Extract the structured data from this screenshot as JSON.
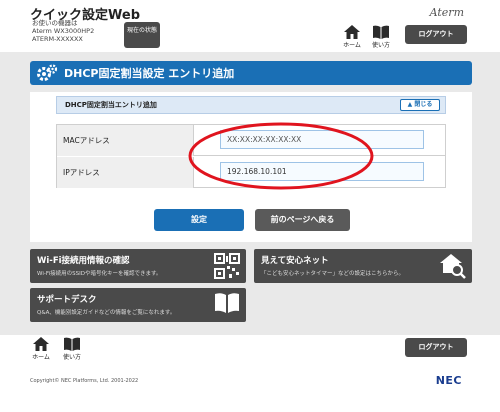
{
  "header": {
    "app_title": "クイック設定Web",
    "device_caption": "お使いの機器は",
    "device_model": "Aterm  WX3000HP2",
    "device_name": "ATERM-XXXXXX",
    "status_button": "現在の状態",
    "brand": "Aterm",
    "home_label": "ホーム",
    "howto_label": "使い方",
    "logout_label": "ログアウト"
  },
  "section": {
    "title": "DHCP固定割当設定 エントリ追加",
    "subsection_title": "DHCP固定割当エントリ追加",
    "close_label": "閉じる"
  },
  "form": {
    "mac_label": "MACアドレス",
    "mac_placeholder": "XX:XX:XX:XX:XX:XX",
    "ip_label": "IPアドレス",
    "ip_value": "192.168.10.101"
  },
  "actions": {
    "submit_label": "設定",
    "back_label": "前のページへ戻る"
  },
  "cards": [
    {
      "title": "Wi-Fi接続用情報の確認",
      "desc": "Wi-Fi接続用のSSIDや暗号化キーを確認できます。",
      "icon": "qr-code-icon"
    },
    {
      "title": "見えて安心ネット",
      "desc": "「こども安心ネットタイマー」などの設定はこちらから。",
      "icon": "house-search-icon"
    },
    {
      "title": "サポートデスク",
      "desc": "Q&A、機能別設定ガイドなどの情報をご覧になれます。",
      "icon": "book-icon"
    }
  ],
  "footer": {
    "home_label": "ホーム",
    "howto_label": "使い方",
    "logout_label": "ログアウト",
    "copyright": "Copyright© NEC Platforms, Ltd. 2001-2022",
    "brand": "NEC"
  },
  "colors": {
    "accent_blue": "#1a6fb5",
    "dark_button": "#4a4a4a",
    "highlight_red": "#e0141e"
  }
}
